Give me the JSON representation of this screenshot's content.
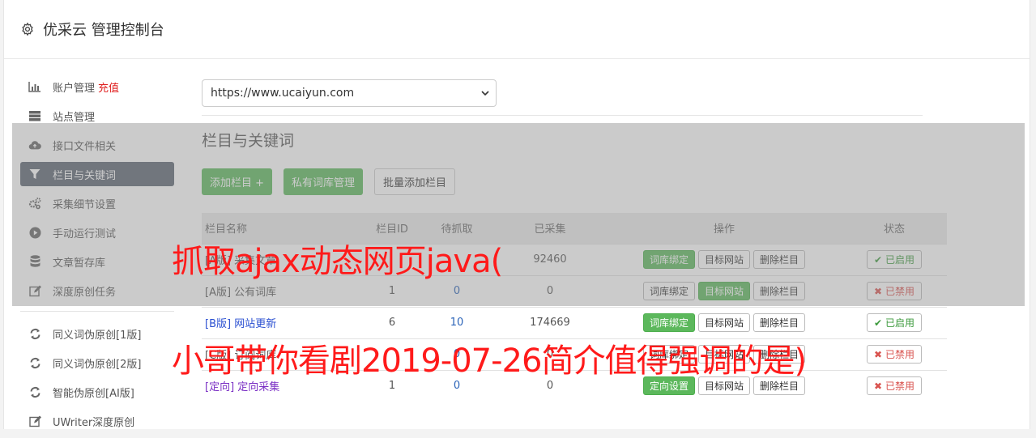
{
  "header": {
    "title": "优采云 管理控制台",
    "icon": "gear-icon"
  },
  "sidebar": {
    "items": [
      {
        "label": "账户管理",
        "extra": "充值",
        "icon": "bar-chart-icon"
      },
      {
        "label": "站点管理",
        "icon": "server-icon"
      },
      {
        "label": "接口文件相关",
        "icon": "cloud-upload-icon"
      },
      {
        "label": "栏目与关键词",
        "icon": "filter-icon",
        "active": true
      },
      {
        "label": "采集细节设置",
        "icon": "cogs-icon"
      },
      {
        "label": "手动运行测试",
        "icon": "play-icon"
      },
      {
        "label": "文章暂存库",
        "icon": "database-icon"
      },
      {
        "label": "深度原创任务",
        "icon": "edit-icon"
      }
    ],
    "items2": [
      {
        "label": "同义词伪原创[1版]",
        "icon": "refresh-icon"
      },
      {
        "label": "同义词伪原创[2版]",
        "icon": "refresh-icon"
      },
      {
        "label": "智能伪原创[AI版]",
        "icon": "refresh-icon"
      },
      {
        "label": "UWriter深度原创",
        "icon": "edit-icon"
      }
    ]
  },
  "site_select": {
    "value": "https://www.ucaiyun.com"
  },
  "section": {
    "title": "栏目与关键词",
    "buttons": {
      "add": "添加栏目 +",
      "private_lib": "私有词库管理",
      "batch_add": "批量添加栏目"
    }
  },
  "table": {
    "headers": {
      "name": "栏目名称",
      "id": "栏目ID",
      "wait": "待抓取",
      "done": "已采集",
      "ops": "操作",
      "status": "状态"
    },
    "rows": [
      {
        "name": "[A版] 采集文章",
        "id": "",
        "wait": "",
        "done": "92460",
        "op1": "词库绑定",
        "op2": "目标网站",
        "op3": "删除栏目",
        "status": "已启用"
      },
      {
        "name": "[A版] 公有词库",
        "id": "1",
        "wait": "0",
        "done": "0",
        "op1": "词库绑定",
        "op2": "目标网站",
        "op3": "删除栏目",
        "status": "已禁用"
      },
      {
        "name": "[B版] 网站更新",
        "id": "6",
        "wait": "10",
        "done": "174669",
        "op1": "词库绑定",
        "op2": "目标网站",
        "op3": "删除栏目",
        "status": "已启用"
      },
      {
        "name": "[C版] 订阅词库",
        "id": "",
        "wait": "0",
        "done": "0",
        "op1": "词库绑定",
        "op2": "目标网站",
        "op3": "删除栏目",
        "status": "已禁用"
      },
      {
        "name": "[定向] 定向采集",
        "id": "1",
        "wait": "0",
        "done": "0",
        "op1": "定向设置",
        "op2": "目标网站",
        "op3": "删除栏目",
        "status": "已禁用"
      }
    ]
  },
  "watermark": {
    "line1": "抓取ajax动态网页java(",
    "line2": "小哥带你看剧2019-07-26简介值得强调的是)"
  },
  "colors": {
    "green": "#5cb85c",
    "sidebar_active": "#5b6472",
    "red": "#e02020"
  }
}
